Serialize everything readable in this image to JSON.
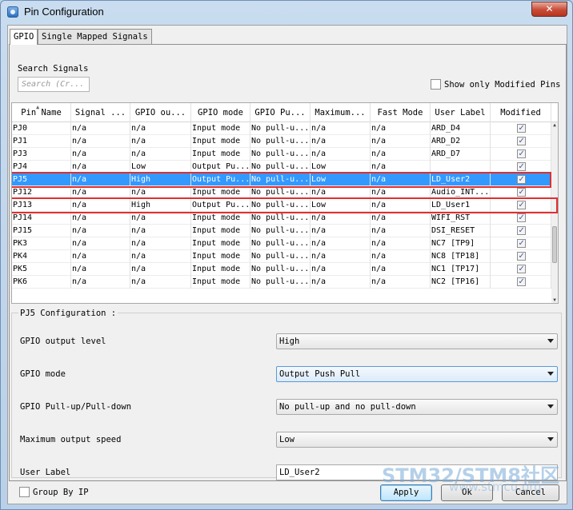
{
  "window": {
    "title": "Pin Configuration",
    "close_label": "✕"
  },
  "tabs": [
    {
      "label": "GPIO",
      "active": true
    },
    {
      "label": "Single Mapped Signals",
      "active": false
    }
  ],
  "search": {
    "label": "Search Signals",
    "placeholder": "Search (Cr..."
  },
  "show_modified": {
    "label": "Show only Modified Pins",
    "checked": false
  },
  "table": {
    "columns": [
      "Pin Name",
      "Signal ...",
      "GPIO ou...",
      "GPIO mode",
      "GPIO Pu...",
      "Maximum...",
      "Fast Mode",
      "User Label",
      "Modified"
    ],
    "rows": [
      [
        "PJ0",
        "n/a",
        "n/a",
        "Input mode",
        "No pull-u...",
        "n/a",
        "n/a",
        "ARD_D4",
        true
      ],
      [
        "PJ1",
        "n/a",
        "n/a",
        "Input mode",
        "No pull-u...",
        "n/a",
        "n/a",
        "ARD_D2",
        true
      ],
      [
        "PJ3",
        "n/a",
        "n/a",
        "Input mode",
        "No pull-u...",
        "n/a",
        "n/a",
        "ARD_D7",
        true
      ],
      [
        "PJ4",
        "n/a",
        "Low",
        "Output Pu...",
        "No pull-u...",
        "Low",
        "n/a",
        "",
        true
      ],
      [
        "PJ5",
        "n/a",
        "High",
        "Output Pu...",
        "No pull-u...",
        "Low",
        "n/a",
        "LD_User2",
        true
      ],
      [
        "PJ12",
        "n/a",
        "n/a",
        "Input mode",
        "No pull-u...",
        "n/a",
        "n/a",
        "Audio_INT...",
        true
      ],
      [
        "PJ13",
        "n/a",
        "High",
        "Output Pu...",
        "No pull-u...",
        "Low",
        "n/a",
        "LD_User1",
        true
      ],
      [
        "PJ14",
        "n/a",
        "n/a",
        "Input mode",
        "No pull-u...",
        "n/a",
        "n/a",
        "WIFI_RST",
        true
      ],
      [
        "PJ15",
        "n/a",
        "n/a",
        "Input mode",
        "No pull-u...",
        "n/a",
        "n/a",
        "DSI_RESET",
        true
      ],
      [
        "PK3",
        "n/a",
        "n/a",
        "Input mode",
        "No pull-u...",
        "n/a",
        "n/a",
        "NC7 [TP9]",
        true
      ],
      [
        "PK4",
        "n/a",
        "n/a",
        "Input mode",
        "No pull-u...",
        "n/a",
        "n/a",
        "NC8 [TP18]",
        true
      ],
      [
        "PK5",
        "n/a",
        "n/a",
        "Input mode",
        "No pull-u...",
        "n/a",
        "n/a",
        "NC1 [TP17]",
        true
      ],
      [
        "PK6",
        "n/a",
        "n/a",
        "Input mode",
        "No pull-u...",
        "n/a",
        "n/a",
        "NC2 [TP16]",
        true
      ]
    ],
    "selected_row": 4
  },
  "config": {
    "title": "PJ5 Configuration :",
    "fields": [
      {
        "label": "GPIO output level",
        "value": "High",
        "type": "select"
      },
      {
        "label": "GPIO mode",
        "value": "Output Push Pull",
        "type": "select"
      },
      {
        "label": "GPIO Pull-up/Pull-down",
        "value": "No pull-up and no pull-down",
        "type": "select"
      },
      {
        "label": "Maximum output speed",
        "value": "Low",
        "type": "select"
      },
      {
        "label": "User Label",
        "value": "LD_User2",
        "type": "text"
      }
    ]
  },
  "group_by_ip": {
    "label": "Group By IP",
    "checked": false
  },
  "buttons": {
    "apply": "Apply",
    "ok": "Ok",
    "cancel": "Cancel"
  },
  "watermark": {
    "text": "STM32/STM8社区",
    "url": "www.stmcu.org"
  },
  "colors": {
    "selection": "#3399ff",
    "highlight": "#e03030",
    "close": "#c74b37"
  },
  "icons": {
    "app": "app-gear-icon",
    "close": "close-icon",
    "dropdown": "chevron-down-icon",
    "sort": "sort-up-icon"
  }
}
